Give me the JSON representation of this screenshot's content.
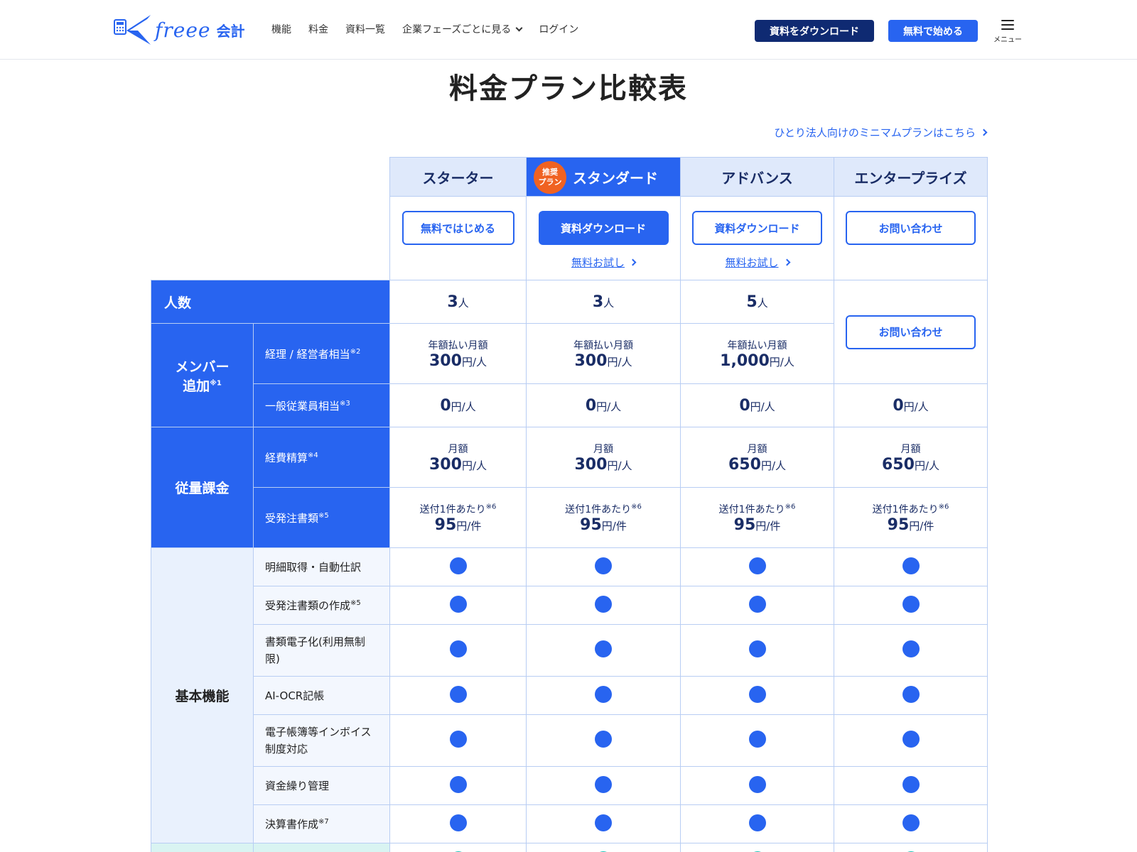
{
  "colors": {
    "accent": "#2864f0",
    "navy": "#0f2a72",
    "badge": "#f06222"
  },
  "header": {
    "logo_word": "freee",
    "logo_suffix": "会計",
    "nav": [
      "機能",
      "料金",
      "資料一覧",
      "企業フェーズごとに見る",
      "ログイン"
    ],
    "download_label": "資料をダウンロード",
    "start_label": "無料で始める",
    "menu_label": "メニュー"
  },
  "title": "料金プラン比較表",
  "mini_plan_link": "ひとり法人向けのミニマムプランはこちら",
  "plans": [
    {
      "name": "スターター",
      "cta": "無料ではじめる",
      "trial": ""
    },
    {
      "name": "スタンダード",
      "badge": "推奨\nプラン",
      "badge_l1": "推奨",
      "badge_l2": "プラン",
      "cta": "資料ダウンロード",
      "trial": "無料お試し"
    },
    {
      "name": "アドバンス",
      "cta": "資料ダウンロード",
      "trial": "無料お試し"
    },
    {
      "name": "エンタープライズ",
      "cta": "お問い合わせ",
      "trial": ""
    }
  ],
  "rows": {
    "people": {
      "label": "人数",
      "unit": "人",
      "values": [
        "3",
        "3",
        "5"
      ],
      "enterprise_cta": "お問い合わせ"
    },
    "member": {
      "label_l1": "メンバー",
      "label_l2": "追加",
      "note": "※1",
      "accounting": {
        "label": "経理 / 経営者相当",
        "note": "※2",
        "prefix": "年額払い月額",
        "unit": "円/人",
        "values": [
          "300",
          "300",
          "1,000"
        ]
      },
      "general": {
        "label": "一般従業員相当",
        "note": "※3",
        "unit": "円/人",
        "values": [
          "0",
          "0",
          "0",
          "0"
        ]
      }
    },
    "usage": {
      "label": "従量課金",
      "expense": {
        "label": "経費精算",
        "note": "※4",
        "prefix": "月額",
        "unit": "円/人",
        "values": [
          "300",
          "300",
          "650",
          "650"
        ]
      },
      "orders": {
        "label": "受発注書類",
        "note": "※5",
        "prefix": "送付1件あたり",
        "prefix_note": "※6",
        "unit": "円/件",
        "values": [
          "95",
          "95",
          "95",
          "95"
        ]
      }
    },
    "basic": {
      "label": "基本機能",
      "features": [
        {
          "label": "明細取得・自動仕訳",
          "note": ""
        },
        {
          "label": "受発注書類の作成",
          "note": "※5"
        },
        {
          "label": "書類電子化(利用無制限)",
          "note": ""
        },
        {
          "label": "AI-OCR記帳",
          "note": ""
        },
        {
          "label": "電子帳簿等インボイス制度対応",
          "note": ""
        },
        {
          "label": "資金繰り管理",
          "note": ""
        },
        {
          "label": "決算書作成",
          "note": "※7"
        }
      ]
    }
  }
}
